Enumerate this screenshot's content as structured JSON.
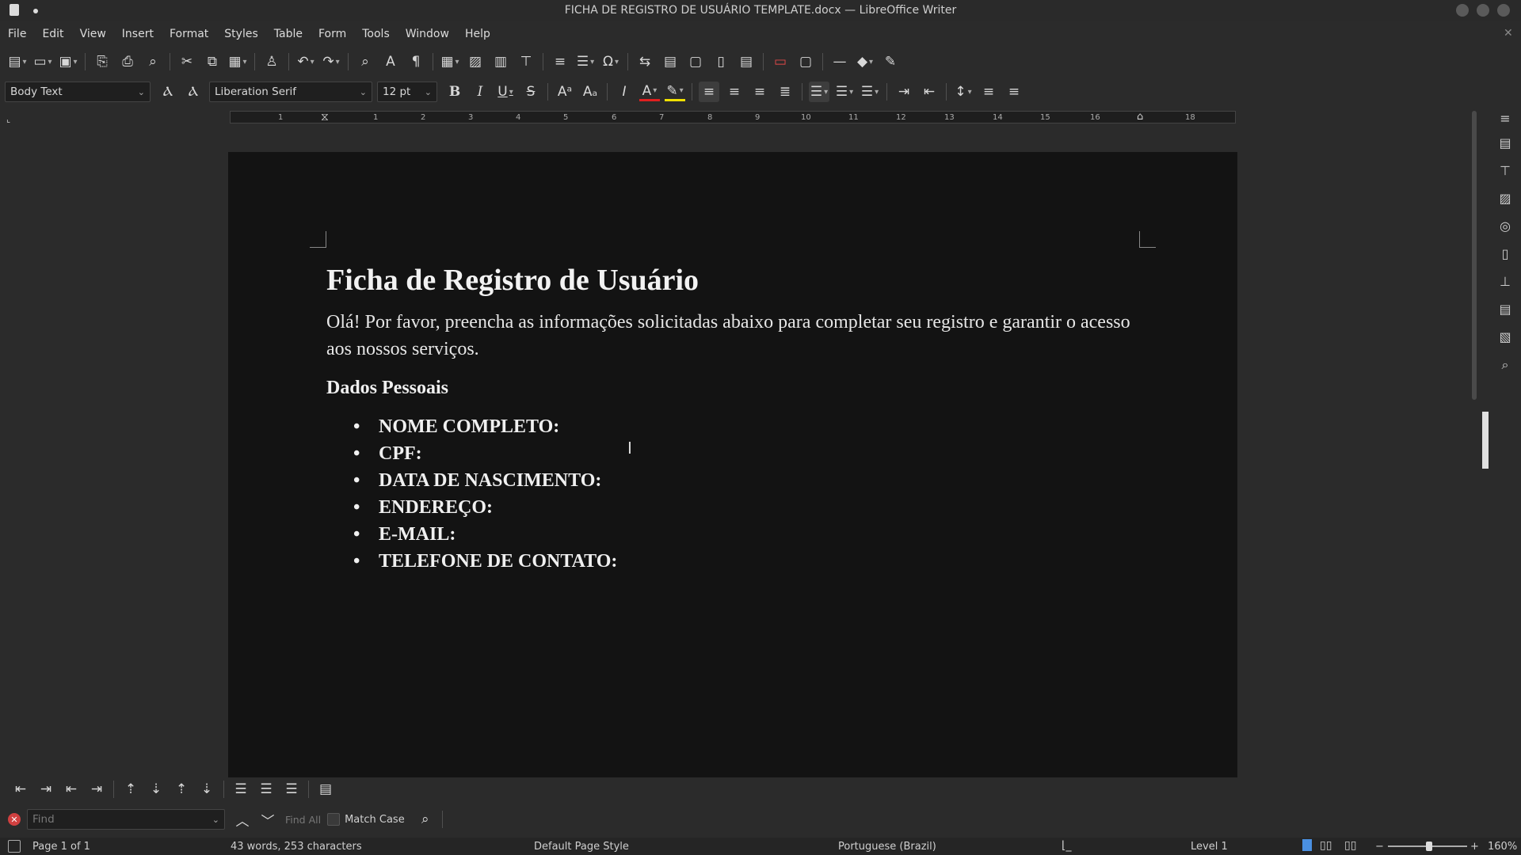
{
  "window": {
    "title": "FICHA DE REGISTRO DE USUÁRIO TEMPLATE.docx — LibreOffice Writer"
  },
  "menu": [
    "File",
    "Edit",
    "View",
    "Insert",
    "Format",
    "Styles",
    "Table",
    "Form",
    "Tools",
    "Window",
    "Help"
  ],
  "formatting": {
    "paragraph_style": "Body Text",
    "font_name": "Liberation Serif",
    "font_size": "12 pt"
  },
  "ruler": {
    "ticks": [
      "1",
      "1",
      "2",
      "3",
      "4",
      "5",
      "6",
      "7",
      "8",
      "9",
      "10",
      "11",
      "12",
      "13",
      "14",
      "15",
      "16",
      "18"
    ]
  },
  "document": {
    "title": "Ficha de Registro de Usuário",
    "intro": "Olá! Por favor, preencha as informações solicitadas abaixo para completar seu registro e garantir o acesso aos nossos serviços.",
    "section_heading": "Dados Pessoais",
    "fields": [
      "NOME COMPLETO:",
      "CPF:",
      "DATA DE NASCIMENTO:",
      "ENDEREÇO:",
      "E-MAIL:",
      "TELEFONE DE CONTATO:"
    ]
  },
  "findbar": {
    "placeholder": "Find",
    "find_all": "Find All",
    "match_case": "Match Case"
  },
  "statusbar": {
    "page": "Page 1 of 1",
    "counts": "43 words, 253 characters",
    "page_style": "Default Page Style",
    "language": "Portuguese (Brazil)",
    "level": "Level 1",
    "zoom": "160%"
  },
  "colors": {
    "font_color_swatch": "#e02020",
    "highlight_swatch": "#f0e000",
    "close_find": "#d04040"
  }
}
